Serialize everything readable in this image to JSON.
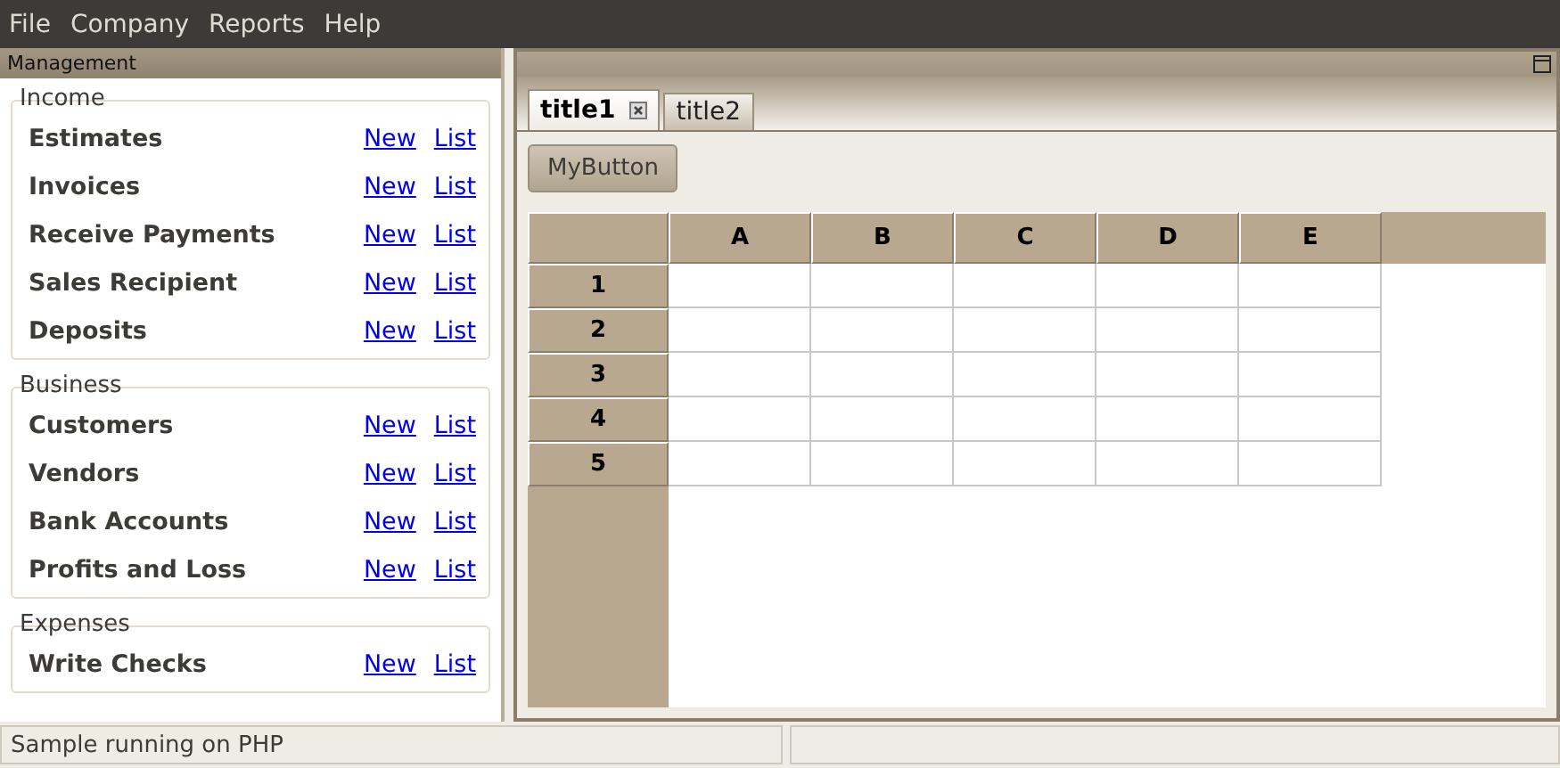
{
  "menu": [
    "File",
    "Company",
    "Reports",
    "Help"
  ],
  "sidebar": {
    "title": "Management",
    "groups": [
      {
        "title": "Income",
        "items": [
          {
            "label": "Estimates",
            "new": "New",
            "list": "List"
          },
          {
            "label": "Invoices",
            "new": "New",
            "list": "List"
          },
          {
            "label": "Receive Payments",
            "new": "New",
            "list": "List"
          },
          {
            "label": "Sales Recipient",
            "new": "New",
            "list": "List"
          },
          {
            "label": "Deposits",
            "new": "New",
            "list": "List"
          }
        ]
      },
      {
        "title": "Business",
        "items": [
          {
            "label": "Customers",
            "new": "New",
            "list": "List"
          },
          {
            "label": "Vendors",
            "new": "New",
            "list": "List"
          },
          {
            "label": "Bank Accounts",
            "new": "New",
            "list": "List"
          },
          {
            "label": "Profits and Loss",
            "new": "New",
            "list": "List"
          }
        ]
      },
      {
        "title": "Expenses",
        "items": [
          {
            "label": "Write Checks",
            "new": "New",
            "list": "List"
          }
        ]
      }
    ]
  },
  "tabs": [
    {
      "label": "title1",
      "selected": true,
      "closable": true
    },
    {
      "label": "title2",
      "selected": false,
      "closable": false
    }
  ],
  "button": "MyButton",
  "table": {
    "columns": [
      "A",
      "B",
      "C",
      "D",
      "E"
    ],
    "rows": [
      "1",
      "2",
      "3",
      "4",
      "5"
    ]
  },
  "status_bar": [
    "Sample running on PHP"
  ]
}
